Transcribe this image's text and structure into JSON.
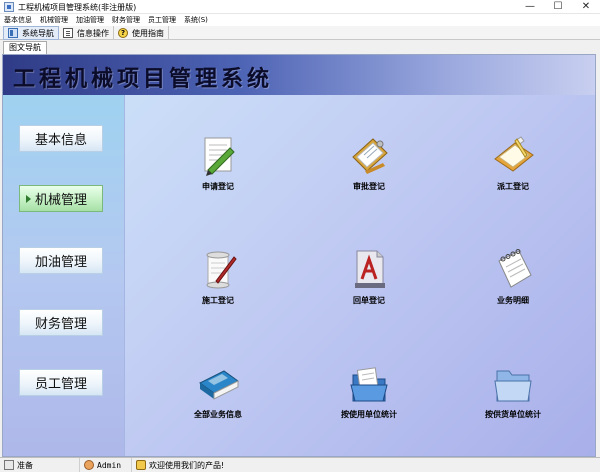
{
  "window": {
    "title": "工程机械项目管理系统(非注册版)",
    "controls": [
      "—",
      "☐",
      "✕"
    ]
  },
  "menu": [
    "基本信息",
    "机械管理",
    "加油管理",
    "财务管理",
    "员工管理",
    "系统(S)"
  ],
  "toolbar": [
    {
      "label": "系统导航",
      "icon": "nav-icon"
    },
    {
      "label": "信息操作",
      "icon": "info-icon"
    },
    {
      "label": "使用指南",
      "icon": "help-icon",
      "glyph": "?"
    }
  ],
  "tab": {
    "label": "图文导航"
  },
  "header": {
    "title": "工程机械项目管理系统"
  },
  "sidebar": {
    "items": [
      {
        "label": "基本信息",
        "active": false
      },
      {
        "label": "机械管理",
        "active": true
      },
      {
        "label": "加油管理",
        "active": false
      },
      {
        "label": "财务管理",
        "active": false
      },
      {
        "label": "员工管理",
        "active": false
      }
    ]
  },
  "tiles": [
    {
      "label": "申请登记",
      "icon": "pen-paper-icon"
    },
    {
      "label": "审批登记",
      "icon": "clipboard-icon"
    },
    {
      "label": "派工登记",
      "icon": "notebook-pencil-icon"
    },
    {
      "label": "施工登记",
      "icon": "scroll-quill-icon"
    },
    {
      "label": "回单登记",
      "icon": "font-document-icon"
    },
    {
      "label": "业务明细",
      "icon": "spiral-notepad-icon"
    },
    {
      "label": "全部业务信息",
      "icon": "book-stack-icon"
    },
    {
      "label": "按使用单位统计",
      "icon": "folder-documents-icon"
    },
    {
      "label": "按供货单位统计",
      "icon": "folder-icon"
    }
  ],
  "status": {
    "ready": "准备",
    "user": "Admin",
    "message": "欢迎使用我们的产品!"
  },
  "colors": {
    "header_dark": "#2f3b86",
    "accent_green": "#a6e0a6",
    "body_blue": "#c2cdf3"
  }
}
